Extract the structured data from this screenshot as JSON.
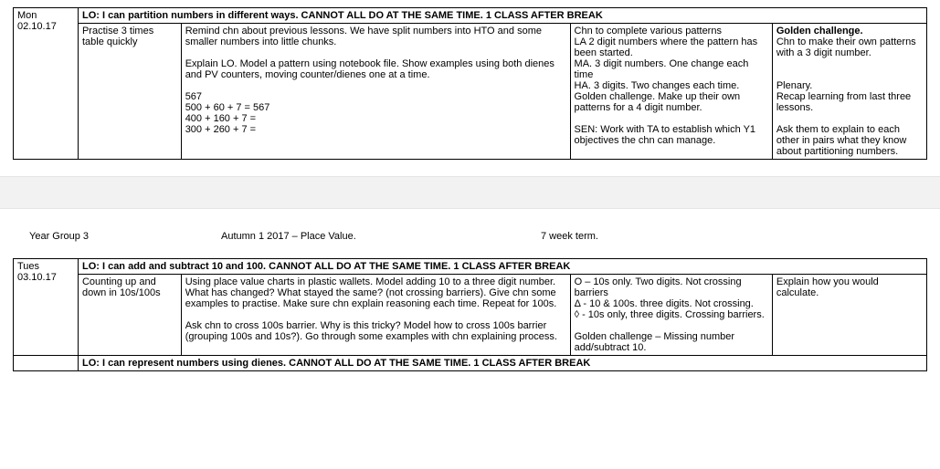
{
  "row1": {
    "date_day": "Mon",
    "date_num": "02.10.17",
    "starter": "Practise 3 times table quickly",
    "lo": "LO: I can partition numbers in different ways. CANNOT ALL DO AT THE SAME TIME. 1 CLASS AFTER BREAK",
    "main_part1": "Remind chn about previous lessons.  We have split numbers into HTO and some smaller numbers into little chunks.",
    "main_part2": "Explain LO.  Model a pattern using notebook file. Show examples using both dienes and PV counters, moving counter/dienes one at a time.",
    "main_ex1": "567",
    "main_ex2": "500 + 60 + 7 = 567",
    "main_ex3": "400 + 160 + 7 =",
    "main_ex4": "300 + 260 + 7 =",
    "diff_l1": "Chn to complete various patterns",
    "diff_l2": "LA 2 digit numbers where the pattern has been started.",
    "diff_l3": "MA.  3 digit numbers. One change each time",
    "diff_l4": "HA.  3 digits. Two changes each time.",
    "diff_l5": "Golden challenge.  Make up their own patterns for a 4 digit number.",
    "diff_sen": "SEN:  Work with TA to establish which Y1 objectives the chn can manage.",
    "plen_gc_title": "Golden challenge.",
    "plen_gc_body": "Chn to make their own patterns with a 3 digit number.",
    "plen_title": "Plenary.",
    "plen_body": "Recap learning from last three lessons.",
    "plen_extra": "Ask them to explain to each other in pairs what they know about partitioning numbers."
  },
  "header": {
    "year_group": "Year Group 3",
    "unit": "Autumn 1 2017 – Place Value.",
    "term": "7 week term."
  },
  "row2": {
    "date_day": "Tues",
    "date_num": "03.10.17",
    "starter": "Counting up and down in 10s/100s",
    "lo": "LO: I can add and subtract 10 and 100. CANNOT ALL DO AT THE SAME TIME. 1 CLASS AFTER BREAK",
    "main_part1": "Using place value charts in plastic wallets. Model adding 10 to a three digit number. What has changed? What stayed the same? (not crossing barriers). Give chn some examples to practise. Make sure chn explain reasoning each time. Repeat for 100s.",
    "main_part2": "Ask chn to cross 100s barrier. Why is this tricky? Model how to cross 100s barrier (grouping 100s and 10s?). Go through some examples with chn explaining process.",
    "diff_l1": "O – 10s only. Two digits. Not crossing barriers",
    "diff_l2": "Δ - 10 & 100s. three digits. Not crossing.",
    "diff_l3": "◊ - 10s only, three digits. Crossing barriers.",
    "diff_gc": "Golden challenge – Missing number add/subtract 10.",
    "plen": "Explain how you would calculate."
  },
  "row3_lo": "LO: I can represent numbers using dienes. CANNOT ALL DO AT THE SAME TIME. 1 CLASS AFTER BREAK"
}
